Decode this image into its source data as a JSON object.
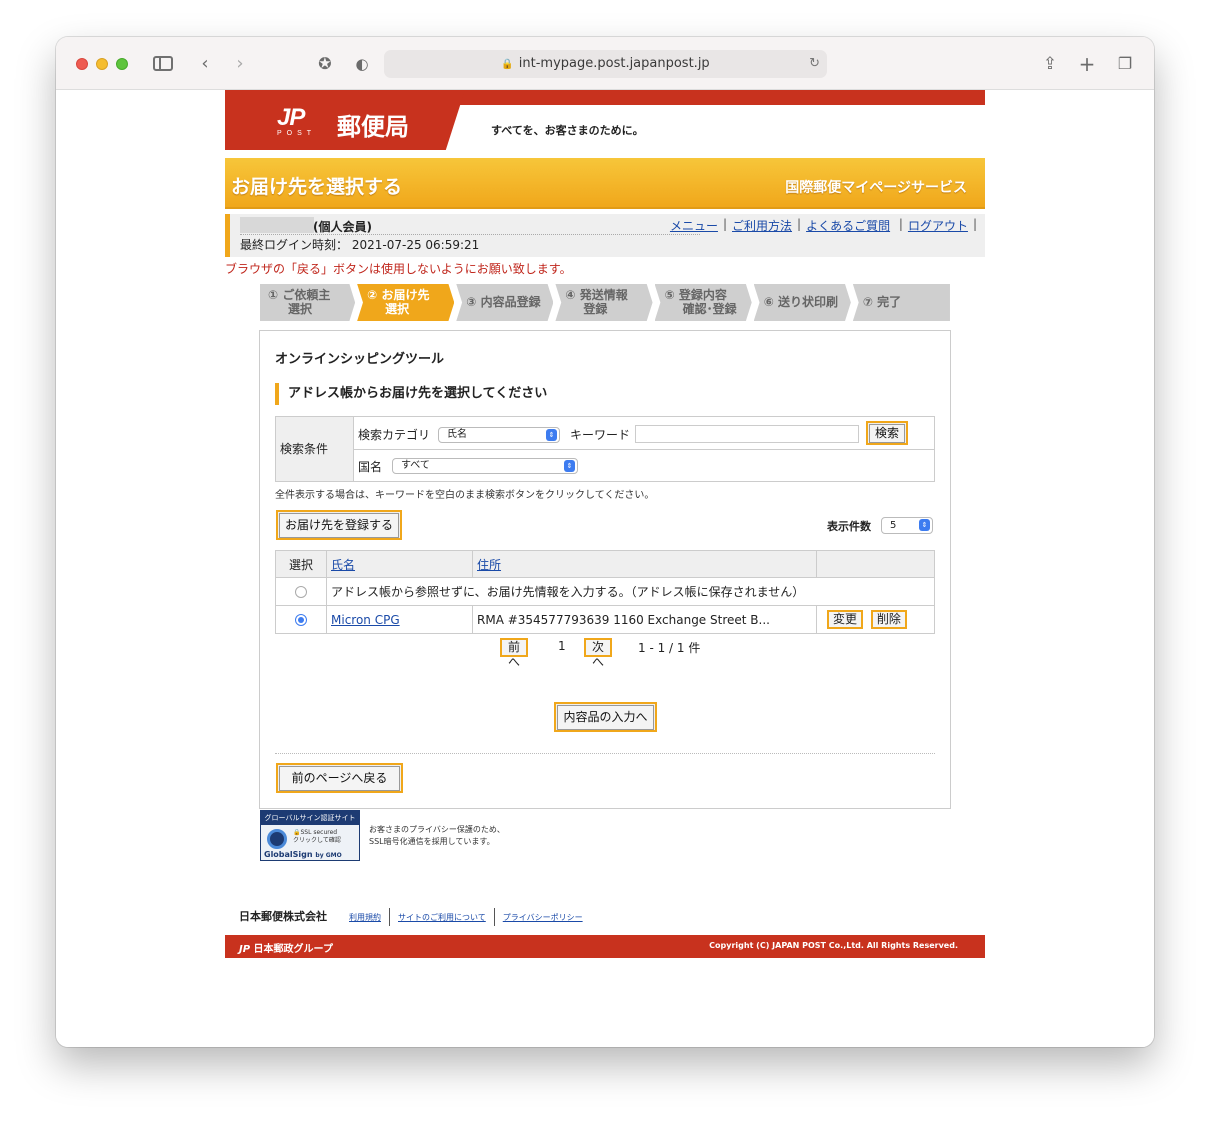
{
  "browser": {
    "url": "int-mypage.post.japanpost.jp"
  },
  "header": {
    "logo_mark": "JP",
    "logo_post": "POST",
    "brand": "郵便局",
    "slogan": "すべてを、お客さまのために。"
  },
  "banner": {
    "title": "お届け先を選択する",
    "service": "国際郵便マイページサービス"
  },
  "user": {
    "member_type": "(個人会員)",
    "last_login_label": "最終ログイン時刻：",
    "last_login": "2021-07-25 06:59:21"
  },
  "topnav": {
    "menu": "メニュー",
    "howto": "ご利用方法",
    "faq": "よくあるご質問",
    "logout": "ログアウト"
  },
  "warning": "ブラウザの「戻る」ボタンは使用しないようにお願い致します。",
  "steps": [
    {
      "line1": "① ご依頼主",
      "line2": "選択"
    },
    {
      "line1": "② お届け先",
      "line2": "選択"
    },
    {
      "line1": "③ 内容品登録",
      "line2": ""
    },
    {
      "line1": "④ 発送情報",
      "line2": "登録"
    },
    {
      "line1": "⑤ 登録内容",
      "line2": "確認･登録"
    },
    {
      "line1": "⑥ 送り状印刷",
      "line2": ""
    },
    {
      "line1": "⑦ 完了",
      "line2": ""
    }
  ],
  "panel": {
    "tool_title": "オンラインシッピングツール",
    "section_title": "アドレス帳からお届け先を選択してください"
  },
  "search": {
    "conditions_label": "検索条件",
    "category_label": "検索カテゴリ",
    "category_value": "氏名",
    "keyword_label": "キーワード",
    "keyword_value": "",
    "search_button": "検索",
    "country_label": "国名",
    "country_value": "すべて",
    "note": "全件表示する場合は、キーワードを空白のまま検索ボタンをクリックしてください。"
  },
  "register_button": "お届け先を登録する",
  "per_page": {
    "label": "表示件数",
    "value": "5"
  },
  "table": {
    "headers": [
      "選択",
      "氏名",
      "住所",
      ""
    ],
    "direct_entry_text": "アドレス帳から参照せずに、お届け先情報を入力する。（アドレス帳に保存されません）",
    "rows": [
      {
        "selected": true,
        "name": "Micron CPG",
        "address": "RMA #354577793639 1160 Exchange Street B...",
        "edit": "変更",
        "delete": "削除"
      }
    ]
  },
  "pager": {
    "prev": "前へ",
    "page": "1",
    "next": "次へ",
    "range": "1 - 1 / 1 件"
  },
  "next_button": "内容品の入力へ",
  "back_button": "前のページへ戻る",
  "ssl": {
    "badge_title": "グローバルサイン認証サイト",
    "secured": "SSL secured",
    "click": "クリックして確認",
    "brand": "GlobalSign",
    "by": "by GMO",
    "note_line1": "お客さまのプライバシー保護のため、",
    "note_line2": "SSL暗号化通信を採用しています。"
  },
  "footer": {
    "company": "日本郵便株式会社",
    "links": [
      "利用規約",
      "サイトのご利用について",
      "プライバシーポリシー"
    ],
    "group": "日本郵政グループ",
    "copyright": "Copyright (C) JAPAN POST Co.,Ltd.  All Rights Reserved."
  },
  "colors": {
    "brand_red": "#c8321e",
    "accent_orange": "#f0a71b",
    "link_blue": "#1a4aa8"
  }
}
